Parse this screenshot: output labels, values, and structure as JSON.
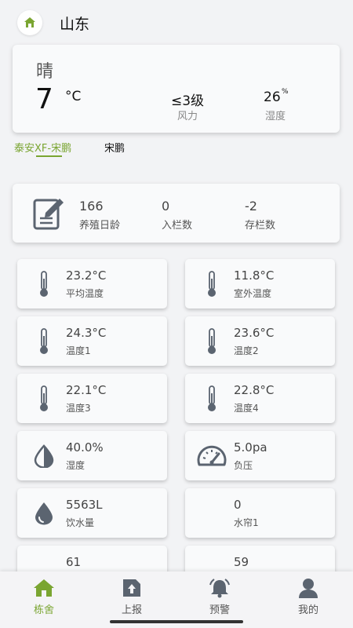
{
  "header": {
    "title": "山东",
    "icon": "home-icon"
  },
  "weather": {
    "condition": "晴",
    "temperature": "7",
    "temperature_unit": "°C",
    "wind_value": "≤3级",
    "wind_label": "风力",
    "humidity_value": "26",
    "humidity_unit": "%",
    "humidity_label": "湿度"
  },
  "tabs": [
    {
      "label": "泰安XF-宋鹏",
      "active": true
    },
    {
      "label": "宋鹏",
      "active": false
    }
  ],
  "summary": {
    "icon": "edit-document-icon",
    "items": [
      {
        "value": "166",
        "label": "养殖日龄"
      },
      {
        "value": "0",
        "label": "入栏数"
      },
      {
        "value": "-2",
        "label": "存栏数"
      }
    ]
  },
  "tiles": [
    {
      "icon": "thermometer-icon",
      "value": "23.2°C",
      "label": "平均温度"
    },
    {
      "icon": "thermometer-icon",
      "value": "11.8°C",
      "label": "室外温度"
    },
    {
      "icon": "thermometer-icon",
      "value": "24.3°C",
      "label": "温度1"
    },
    {
      "icon": "thermometer-icon",
      "value": "23.6°C",
      "label": "温度2"
    },
    {
      "icon": "thermometer-icon",
      "value": "22.1°C",
      "label": "温度3"
    },
    {
      "icon": "thermometer-icon",
      "value": "22.8°C",
      "label": "温度4"
    },
    {
      "icon": "humidity-drop-icon",
      "value": "40.0%",
      "label": "湿度"
    },
    {
      "icon": "gauge-icon",
      "value": "5.0pa",
      "label": "负压"
    },
    {
      "icon": "water-drop-icon",
      "value": "5563L",
      "label": "饮水量"
    },
    {
      "icon": "blank-icon",
      "value": "0",
      "label": "水帘1"
    },
    {
      "icon": "blank-icon",
      "value": "61",
      "label": ""
    },
    {
      "icon": "blank-icon",
      "value": "59",
      "label": ""
    }
  ],
  "nav": [
    {
      "label": "栋舍",
      "icon": "house-icon",
      "active": true
    },
    {
      "label": "上报",
      "icon": "report-icon",
      "active": false
    },
    {
      "label": "预警",
      "icon": "alarm-bell-icon",
      "active": false
    },
    {
      "label": "我的",
      "icon": "user-icon",
      "active": false
    }
  ],
  "colors": {
    "accent": "#7aa531",
    "icon_gray": "#5b6470",
    "background": "#f2f3f5",
    "card": "#f9fafb"
  }
}
